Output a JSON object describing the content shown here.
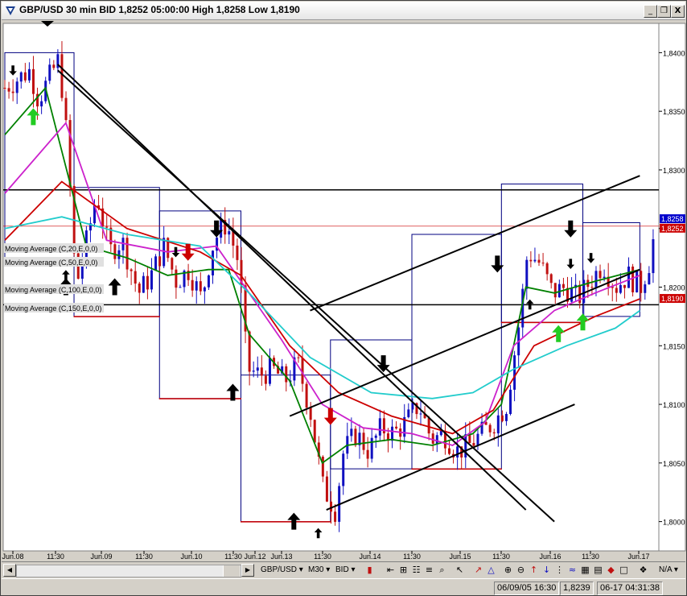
{
  "window": {
    "title": "GBP/USD 30 min BID 1,8252 05:00:00 High 1,8258 Low 1,8190",
    "buttons": [
      "_",
      "❒",
      "X"
    ]
  },
  "chart_data": {
    "type": "candlestick",
    "symbol": "GBP/USD",
    "period": "30 min",
    "ylim": [
      1.7975,
      1.8425
    ],
    "y_ticks": [
      "1,8400",
      "1,8350",
      "1,8300",
      "1,8250",
      "1,8200",
      "1,8150",
      "1,8100",
      "1,8050",
      "1,8000"
    ],
    "x_ticks": [
      "Jun.08",
      "11:30",
      "Jun.09",
      "11:30",
      "Jun.10",
      "11:30",
      "Jun.12",
      "Jun.13",
      "11:30",
      "Jun.14",
      "11:30",
      "Jun.15",
      "11:30",
      "Jun.16",
      "11:30",
      "Jun.17"
    ],
    "price_tags": [
      {
        "label": "1,8258",
        "value": 1.8258,
        "color": "#0000cc"
      },
      {
        "label": "1,8252",
        "value": 1.8252,
        "color": "#cc0000"
      },
      {
        "label": "1,8190",
        "value": 1.819,
        "color": "#cc0000"
      }
    ],
    "moving_averages": [
      {
        "name": "Moving Average (C,20,E,0,0)",
        "color": "#008000"
      },
      {
        "name": "Moving Average (C,50,E,0,0)",
        "color": "#cc22cc"
      },
      {
        "name": "Moving Average (C,100,E,0,0)",
        "color": "#cc0000"
      },
      {
        "name": "Moving Average (C,150,E,0,0)",
        "color": "#22cccc"
      }
    ],
    "colors": {
      "up": "#1010c0",
      "down": "#c01010",
      "background": "#ffffff"
    },
    "close_path": [
      [
        0,
        1.837
      ],
      [
        6,
        1.8385
      ],
      [
        8,
        1.836
      ],
      [
        13,
        1.8395
      ],
      [
        15,
        1.832
      ],
      [
        17,
        1.82
      ],
      [
        19,
        1.823
      ],
      [
        22,
        1.828
      ],
      [
        25,
        1.823
      ],
      [
        28,
        1.824
      ],
      [
        32,
        1.8195
      ],
      [
        35,
        1.821
      ],
      [
        38,
        1.8235
      ],
      [
        41,
        1.8205
      ],
      [
        44,
        1.8215
      ],
      [
        47,
        1.819
      ],
      [
        50,
        1.824
      ],
      [
        53,
        1.8255
      ],
      [
        56,
        1.822
      ],
      [
        58,
        1.813
      ],
      [
        61,
        1.8125
      ],
      [
        64,
        1.813
      ],
      [
        67,
        1.812
      ],
      [
        70,
        1.8135
      ],
      [
        73,
        1.8095
      ],
      [
        76,
        1.803
      ],
      [
        79,
        1.801
      ],
      [
        81,
        1.806
      ],
      [
        84,
        1.8075
      ],
      [
        87,
        1.806
      ],
      [
        90,
        1.808
      ],
      [
        93,
        1.8075
      ],
      [
        96,
        1.8085
      ],
      [
        99,
        1.81
      ],
      [
        102,
        1.807
      ],
      [
        105,
        1.8075
      ],
      [
        108,
        1.806
      ],
      [
        111,
        1.8065
      ],
      [
        114,
        1.8075
      ],
      [
        117,
        1.8085
      ],
      [
        120,
        1.81
      ],
      [
        123,
        1.817
      ],
      [
        125,
        1.823
      ],
      [
        128,
        1.822
      ],
      [
        131,
        1.8195
      ],
      [
        134,
        1.82
      ],
      [
        137,
        1.819
      ],
      [
        140,
        1.8205
      ],
      [
        143,
        1.822
      ],
      [
        146,
        1.82
      ],
      [
        149,
        1.821
      ],
      [
        152,
        1.82
      ],
      [
        154,
        1.822
      ],
      [
        156,
        1.8258
      ]
    ],
    "ma_paths": [
      [
        [
          0,
          1.833
        ],
        [
          10,
          1.837
        ],
        [
          20,
          1.8235
        ],
        [
          30,
          1.8225
        ],
        [
          40,
          1.821
        ],
        [
          50,
          1.8215
        ],
        [
          55,
          1.8215
        ],
        [
          60,
          1.816
        ],
        [
          70,
          1.812
        ],
        [
          78,
          1.805
        ],
        [
          84,
          1.8065
        ],
        [
          95,
          1.807
        ],
        [
          105,
          1.8065
        ],
        [
          115,
          1.8075
        ],
        [
          122,
          1.81
        ],
        [
          128,
          1.82
        ],
        [
          135,
          1.8195
        ],
        [
          145,
          1.8205
        ],
        [
          156,
          1.8215
        ]
      ],
      [
        [
          0,
          1.828
        ],
        [
          15,
          1.834
        ],
        [
          25,
          1.824
        ],
        [
          40,
          1.823
        ],
        [
          52,
          1.8235
        ],
        [
          58,
          1.8205
        ],
        [
          68,
          1.8155
        ],
        [
          78,
          1.81
        ],
        [
          88,
          1.808
        ],
        [
          100,
          1.8075
        ],
        [
          110,
          1.8065
        ],
        [
          118,
          1.8085
        ],
        [
          125,
          1.815
        ],
        [
          135,
          1.818
        ],
        [
          145,
          1.8195
        ],
        [
          156,
          1.821
        ]
      ],
      [
        [
          0,
          1.824
        ],
        [
          14,
          1.829
        ],
        [
          30,
          1.825
        ],
        [
          48,
          1.823
        ],
        [
          58,
          1.821
        ],
        [
          70,
          1.815
        ],
        [
          82,
          1.811
        ],
        [
          95,
          1.809
        ],
        [
          110,
          1.8075
        ],
        [
          120,
          1.8095
        ],
        [
          130,
          1.815
        ],
        [
          145,
          1.8175
        ],
        [
          156,
          1.819
        ]
      ],
      [
        [
          0,
          1.825
        ],
        [
          14,
          1.826
        ],
        [
          30,
          1.8245
        ],
        [
          48,
          1.8235
        ],
        [
          60,
          1.8195
        ],
        [
          75,
          1.814
        ],
        [
          90,
          1.811
        ],
        [
          105,
          1.8105
        ],
        [
          115,
          1.811
        ],
        [
          125,
          1.813
        ],
        [
          138,
          1.815
        ],
        [
          150,
          1.8165
        ],
        [
          156,
          1.818
        ]
      ]
    ],
    "trendlines": [
      [
        [
          13,
          1.839
        ],
        [
          128,
          1.801
        ]
      ],
      [
        [
          13,
          1.8385
        ],
        [
          135,
          1.8
        ]
      ],
      [
        [
          75,
          1.818
        ],
        [
          156,
          1.8295
        ]
      ],
      [
        [
          70,
          1.809
        ],
        [
          156,
          1.8215
        ]
      ],
      [
        [
          79,
          1.801
        ],
        [
          140,
          1.81
        ]
      ]
    ],
    "horizontal_lines": [
      1.8283,
      1.8185
    ],
    "range_boxes": [
      {
        "x0": 0,
        "x1": 17,
        "y0": 1.8225,
        "y1": 1.84,
        "color": "#000080"
      },
      {
        "x0": 17,
        "x1": 38,
        "y0": 1.8175,
        "y1": 1.8285,
        "color": "#000080"
      },
      {
        "x0": 38,
        "x1": 58,
        "y0": 1.8105,
        "y1": 1.8265,
        "color": "#000080"
      },
      {
        "x0": 58,
        "x1": 80,
        "y0": 1.8,
        "y1": 1.8125,
        "color": "#000080"
      },
      {
        "x0": 80,
        "x1": 100,
        "y0": 1.8045,
        "y1": 1.8155,
        "color": "#000080"
      },
      {
        "x0": 100,
        "x1": 122,
        "y0": 1.8045,
        "y1": 1.8245,
        "color": "#000080"
      },
      {
        "x0": 122,
        "x1": 142,
        "y0": 1.817,
        "y1": 1.8288,
        "color": "#000080"
      },
      {
        "x0": 142,
        "x1": 156,
        "y0": 1.8175,
        "y1": 1.8255,
        "color": "#000080"
      },
      {
        "x0": 17,
        "x1": 38,
        "y0": 1.8175,
        "y1": 1.8175,
        "color": "#cc0000"
      },
      {
        "x0": 38,
        "x1": 58,
        "y0": 1.8105,
        "y1": 1.8105,
        "color": "#cc0000"
      },
      {
        "x0": 58,
        "x1": 80,
        "y0": 1.8,
        "y1": 1.8,
        "color": "#cc0000"
      },
      {
        "x0": 100,
        "x1": 122,
        "y0": 1.8045,
        "y1": 1.8045,
        "color": "#cc0000"
      },
      {
        "x0": 122,
        "x1": 142,
        "y0": 1.817,
        "y1": 1.817,
        "color": "#cc0000"
      }
    ],
    "signal_arrows": [
      {
        "x": 2,
        "price": 1.8385,
        "dir": "down",
        "color": "#000000",
        "size": "small"
      },
      {
        "x": 7,
        "price": 1.8345,
        "dir": "up",
        "color": "#22cc22",
        "size": "big"
      },
      {
        "x": 15,
        "price": 1.821,
        "dir": "up",
        "color": "#000000",
        "size": "small"
      },
      {
        "x": 15,
        "price": 1.82,
        "dir": "up",
        "color": "#000000",
        "size": "big"
      },
      {
        "x": 27,
        "price": 1.82,
        "dir": "up",
        "color": "#000000",
        "size": "big"
      },
      {
        "x": 42,
        "price": 1.823,
        "dir": "down",
        "color": "#000000",
        "size": "small"
      },
      {
        "x": 45,
        "price": 1.823,
        "dir": "down",
        "color": "#cc0000",
        "size": "big"
      },
      {
        "x": 52,
        "price": 1.825,
        "dir": "down",
        "color": "#000000",
        "size": "big"
      },
      {
        "x": 56,
        "price": 1.811,
        "dir": "up",
        "color": "#000000",
        "size": "big"
      },
      {
        "x": 71,
        "price": 1.8,
        "dir": "up",
        "color": "#000000",
        "size": "big"
      },
      {
        "x": 77,
        "price": 1.799,
        "dir": "up",
        "color": "#000000",
        "size": "small"
      },
      {
        "x": 80,
        "price": 1.809,
        "dir": "down",
        "color": "#cc0000",
        "size": "big"
      },
      {
        "x": 93,
        "price": 1.8135,
        "dir": "down",
        "color": "#000000",
        "size": "big"
      },
      {
        "x": 121,
        "price": 1.822,
        "dir": "down",
        "color": "#000000",
        "size": "big"
      },
      {
        "x": 129,
        "price": 1.8185,
        "dir": "up",
        "color": "#000000",
        "size": "small"
      },
      {
        "x": 136,
        "price": 1.816,
        "dir": "up",
        "color": "#22cc22",
        "size": "big"
      },
      {
        "x": 139,
        "price": 1.825,
        "dir": "down",
        "color": "#000000",
        "size": "big"
      },
      {
        "x": 139,
        "price": 1.822,
        "dir": "down",
        "color": "#000000",
        "size": "small"
      },
      {
        "x": 142,
        "price": 1.817,
        "dir": "up",
        "color": "#22cc22",
        "size": "big"
      },
      {
        "x": 144,
        "price": 1.8225,
        "dir": "down",
        "color": "#000000",
        "size": "small"
      }
    ]
  },
  "toolbar": {
    "symbol": "GBP/USD",
    "timeframe": "M30",
    "price_side": "BID",
    "dropdown_arrow": "▾"
  },
  "statusbar": {
    "cursor": "06/09/05 16:30",
    "cursor_price": "1,8239",
    "server_time": "06-17 04:31:38",
    "mode": "N/A"
  }
}
